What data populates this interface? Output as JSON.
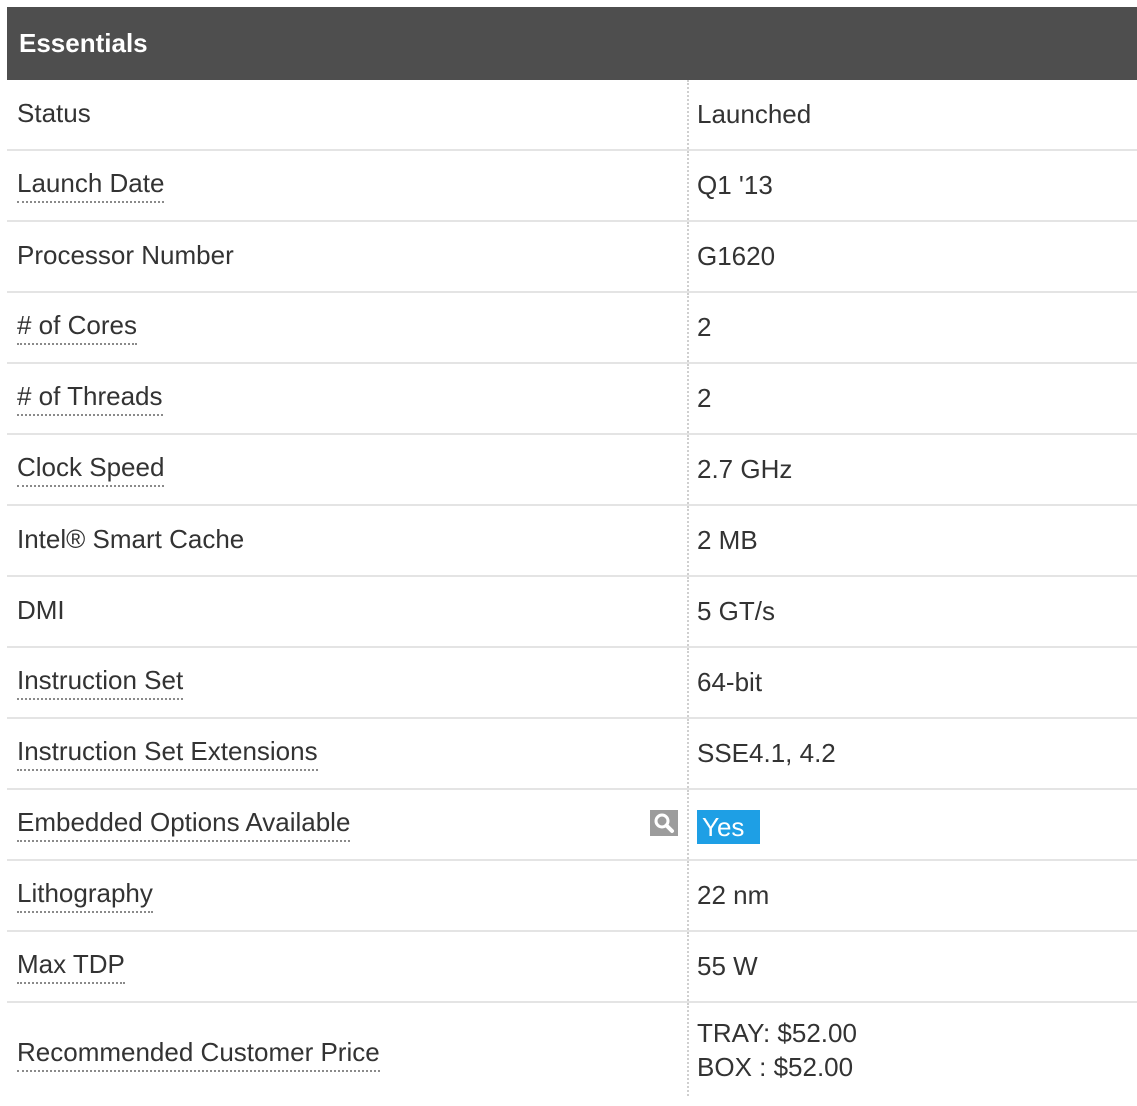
{
  "section": {
    "title": "Essentials"
  },
  "rows": [
    {
      "label": "Status",
      "value": "Launched"
    },
    {
      "label": "Launch Date",
      "value": "Q1 '13"
    },
    {
      "label": "Processor Number",
      "value": "G1620"
    },
    {
      "label": "# of Cores",
      "value": "2"
    },
    {
      "label": "# of Threads",
      "value": "2"
    },
    {
      "label": "Clock Speed",
      "value": "2.7 GHz"
    },
    {
      "label": "Intel® Smart Cache",
      "value": "2 MB"
    },
    {
      "label": "DMI",
      "value": "5 GT/s"
    },
    {
      "label": "Instruction Set",
      "value": "64-bit"
    },
    {
      "label": "Instruction Set Extensions",
      "value": "SSE4.1, 4.2"
    },
    {
      "label": "Embedded Options Available",
      "value": "Yes",
      "icon": "magnifier-icon"
    },
    {
      "label": "Lithography",
      "value": "22 nm"
    },
    {
      "label": "Max TDP",
      "value": "55 W"
    },
    {
      "label": "Recommended Customer Price",
      "values": [
        "TRAY: $52.00",
        "BOX : $52.00"
      ]
    }
  ],
  "colors": {
    "header_bg": "#4e4e4e",
    "header_text": "#ffffff",
    "highlight": "#1e9fe5",
    "icon_bg": "#9c9c9c"
  }
}
